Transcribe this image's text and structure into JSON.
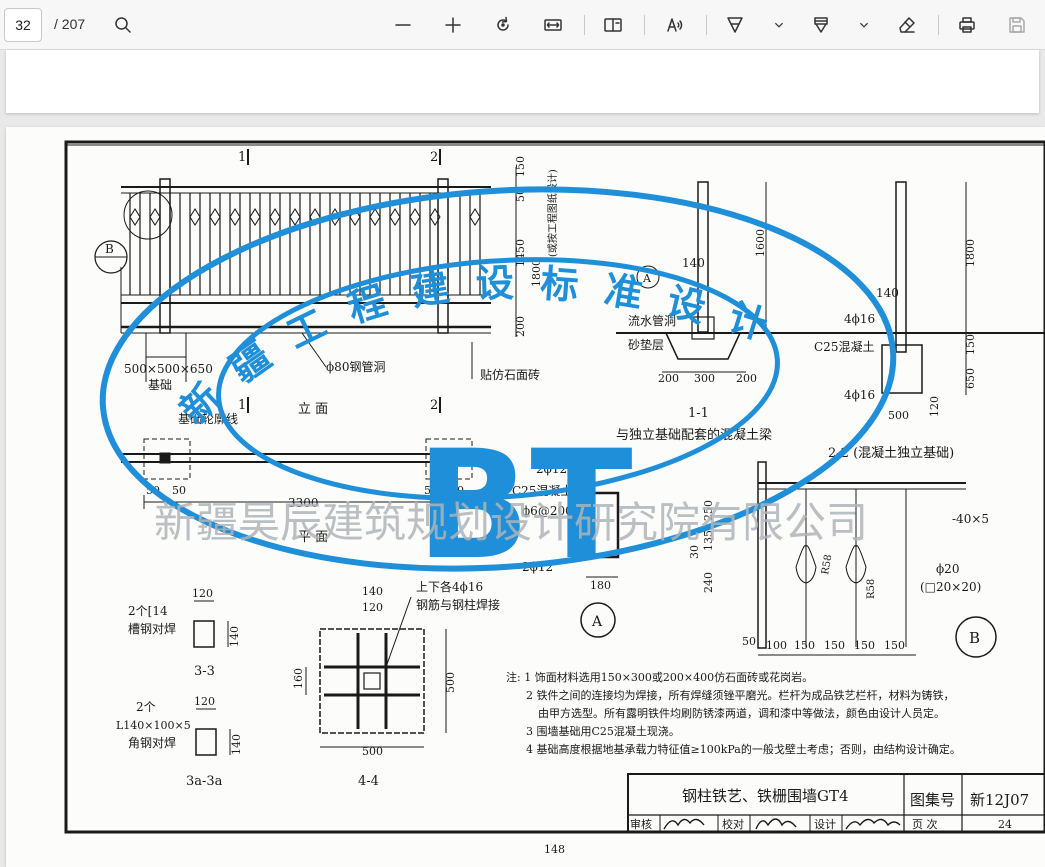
{
  "toolbar": {
    "page_number": "32",
    "page_total": "/ 207",
    "icons": [
      "search-icon",
      "zoom-out-icon",
      "zoom-in-icon",
      "rotate-icon",
      "fit-width-icon",
      "page-view-icon",
      "read-aloud-icon",
      "draw-icon",
      "highlight-icon",
      "eraser-icon",
      "print-icon",
      "save-icon"
    ]
  },
  "drawing": {
    "section_mark_1_top": "1",
    "section_mark_2_top": "2",
    "section_mark_1_bottom": "1",
    "section_mark_2_bottom": "2",
    "dim_50_top": "50",
    "dim_150": "150",
    "dim_1450": "1450",
    "dim_1800_left": "1800",
    "dim_200_left": "200",
    "dim_note_vertical": "(或按工程图纸设计)",
    "label_b_circle": "B",
    "label_foundation_size": "500×500×650",
    "label_foundation": "基础",
    "label_pipe_hole": "ϕ80钢管洞",
    "label_stone_tile": "贴仿石面砖",
    "label_elevation": "立 面",
    "label_foundation_outline": "基础轮廓线",
    "label_plan": "平 面",
    "dim_3300": "3300",
    "dim_50_a": "50",
    "dim_50_b": "50",
    "dim_50_c": "50",
    "dim_50_d": "50",
    "sec11_dim_140": "140",
    "sec11_dim_1600": "1600",
    "sec11_label_drain": "流水管洞",
    "sec11_label_sand": "砂垫层",
    "sec11_dim_200a": "200",
    "sec11_dim_300": "300",
    "sec11_dim_200b": "200",
    "sec11_title": "1-1",
    "sec11_subtitle": "与独立基础配套的混凝土梁",
    "sec11_label_a": "A",
    "sec22_dim_140": "140",
    "sec22_dim_1800": "1800",
    "sec22_rebar_top": "4ϕ16",
    "sec22_concrete": "C25混凝土",
    "sec22_rebar_bottom": "4ϕ16",
    "sec22_dim_150": "150",
    "sec22_dim_650": "650",
    "sec22_dim_500": "500",
    "sec22_dim_120": "120",
    "sec22_title": "2-2 (混凝土独立基础)",
    "secA_rebar_top": "2ϕ12",
    "secA_concrete": "C25混凝土",
    "secA_stirrup": "ϕ6@200",
    "secA_rebar_bottom": "2ϕ12",
    "secA_dim_180": "180",
    "secA_label": "A",
    "detB_dim_40x5": "-40×5",
    "detB_dim_phi20": "ϕ20",
    "detB_dim_square": "(□20×20)",
    "detB_dim_250": "250",
    "detB_dim_135": "135",
    "detB_dim_30": "30",
    "detB_dim_240": "240",
    "detB_dim_r58a": "R58",
    "detB_dim_r58b": "R58",
    "detB_bottom_dims": [
      "50",
      "100",
      "150",
      "150",
      "150",
      "150"
    ],
    "detB_label": "B",
    "sec33_dim_120": "120",
    "sec33_dim_140": "140",
    "sec33_label1": "2个[14",
    "sec33_label2": "槽钢对焊",
    "sec33_title": "3-3",
    "sec3a_dim_120": "120",
    "sec3a_dim_140": "140",
    "sec3a_label1": "2个",
    "sec3a_label2": "L140×100×5",
    "sec3a_label3": "角钢对焊",
    "sec3a_title": "3a-3a",
    "sec44_dim_140": "140",
    "sec44_dim_120": "120",
    "sec44_label1": "上下各4ϕ16",
    "sec44_label2": "钢筋与钢柱焊接",
    "sec44_dim_160": "160",
    "sec44_dim_500v": "500",
    "sec44_dim_500h": "500",
    "sec44_title": "4-4",
    "notes": [
      "注: 1  饰面材料选用150×300或200×400仿石面砖或花岗岩。",
      "2  铁件之间的连接均为焊接，所有焊缝须锉平磨光。栏杆为成品铁艺栏杆，材料为铸铁，",
      "由甲方选型。所有露明铁件均刷防锈漆两道，调和漆中等做法，颜色由设计人员定。",
      "3  围墙基础用C25混凝土现浇。",
      "4  基础高度根据地基承载力特征值≥100kPa的一般戈壁土考虑；否则，由结构设计确定。"
    ],
    "title_block": {
      "title": "钢柱铁艺、铁栅围墙GT4",
      "atlas_label": "图集号",
      "atlas_number": "新12J07",
      "review_label": "审核",
      "check_label": "校对",
      "design_label": "设计",
      "page_label": "页 次",
      "page_value": "24"
    },
    "page_footer": "148"
  },
  "watermark": {
    "arc_text": "新 疆 工 程 建 设 标 准 设 计",
    "logo": "BT",
    "org_name": "新疆昊辰建筑规划设计研究院有限公司"
  },
  "colors": {
    "watermark": "#1e8fd8",
    "watermark_text": "#aeb4b8",
    "line": "#1a1a1a"
  }
}
